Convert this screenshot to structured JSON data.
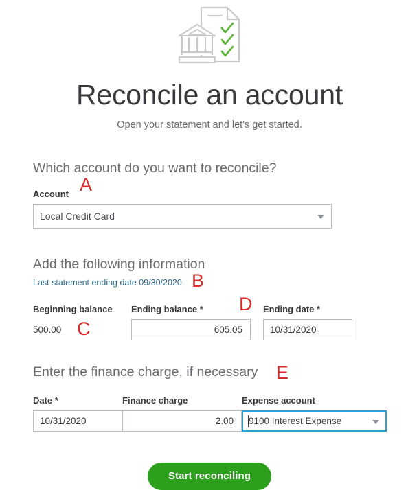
{
  "header": {
    "icon_name": "bank-statement-checklist-icon",
    "title": "Reconcile an account",
    "subtitle": "Open your statement and let's get started."
  },
  "section_account": {
    "heading": "Which account do you want to reconcile?",
    "account_label": "Account",
    "account_value": "Local Credit Card",
    "account_options": [
      "Local Credit Card"
    ]
  },
  "section_information": {
    "heading": "Add the following information",
    "statement_link": "Last statement ending date 09/30/2020",
    "beginning_balance_label": "Beginning balance",
    "beginning_balance_value": "500.00",
    "ending_balance_label": "Ending balance *",
    "ending_balance_value": "605.05",
    "ending_date_label": "Ending date *",
    "ending_date_value": "10/31/2020"
  },
  "section_finance_charge": {
    "heading": "Enter the finance charge, if necessary",
    "date_label": "Date *",
    "date_value": "10/31/2020",
    "finance_charge_label": "Finance charge",
    "finance_charge_value": "2.00",
    "expense_account_label": "Expense account",
    "expense_account_value": "9100 Interest Expense",
    "expense_account_options": [
      "9100 Interest Expense"
    ]
  },
  "footer": {
    "start_button": "Start reconciling"
  },
  "annotations": {
    "a": "A",
    "b": "B",
    "c": "C",
    "d": "D",
    "e": "E"
  },
  "colors": {
    "brand_green": "#2ca01c",
    "link_blue": "#2e6b8e",
    "focus_blue": "#2ca0d8",
    "annotation_red": "#d52b2b",
    "text_dark": "#393a3d",
    "text_muted": "#6b6c72",
    "border_gray": "#babec5",
    "check_green": "#5cb335"
  }
}
